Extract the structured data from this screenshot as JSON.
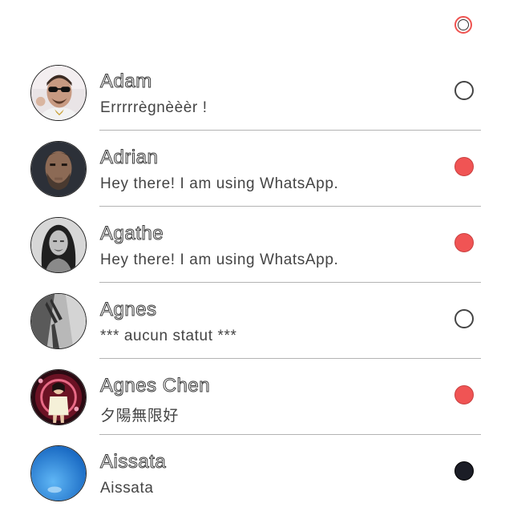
{
  "header": {
    "select_all_state": "partial"
  },
  "contacts": [
    {
      "name": "Adam",
      "status": "Errrrrègnèèèr !",
      "selection": "off",
      "avatar": "avatar-adam"
    },
    {
      "name": "Adrian",
      "status": "Hey there! I am using WhatsApp.",
      "selection": "red",
      "avatar": "avatar-adrian"
    },
    {
      "name": "Agathe",
      "status": "Hey there! I am using WhatsApp.",
      "selection": "red",
      "avatar": "avatar-agathe"
    },
    {
      "name": "Agnes",
      "status": "*** aucun statut ***",
      "selection": "off",
      "avatar": "avatar-agnes"
    },
    {
      "name": "Agnes Chen",
      "status": "夕陽無限好",
      "selection": "red",
      "avatar": "avatar-agnes-chen"
    },
    {
      "name": "Aissata",
      "status": "Aissata",
      "selection": "black",
      "avatar": "avatar-aissata"
    }
  ],
  "colors": {
    "selected": "#f05454",
    "dark_selected": "#1b1d26",
    "divider": "#b3b3b3"
  }
}
